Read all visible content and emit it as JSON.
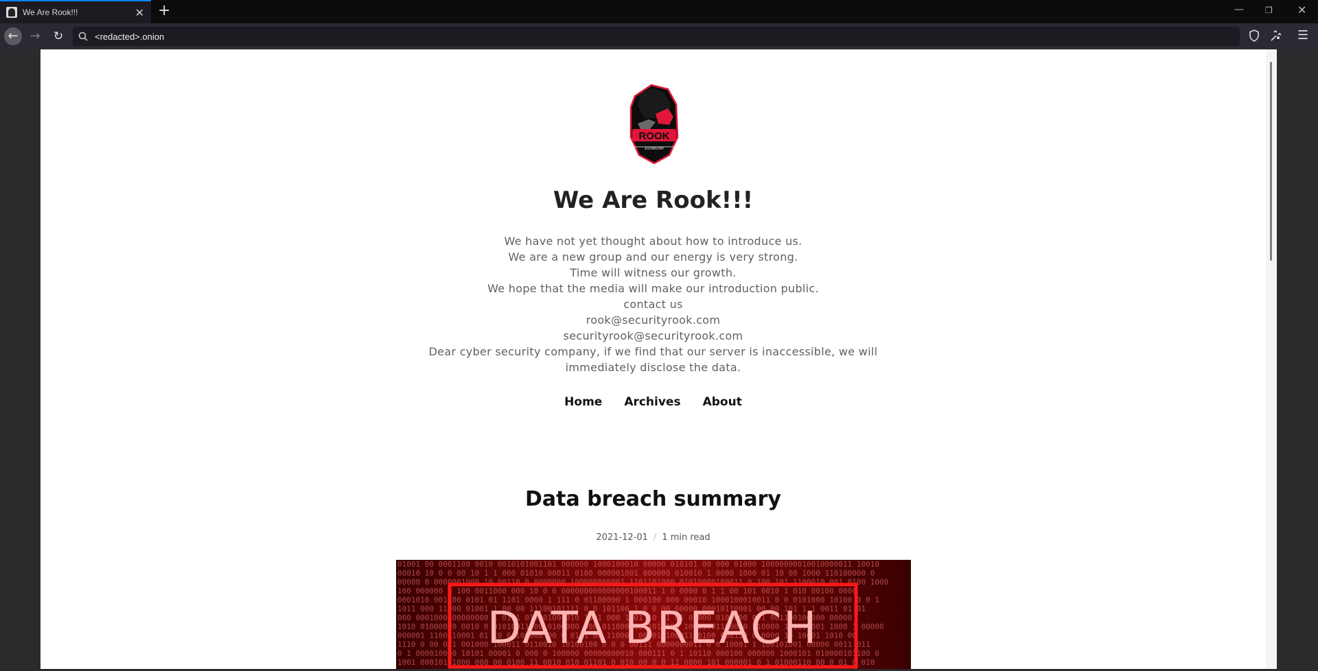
{
  "browser": {
    "tab_title": "We Are Rook!!!",
    "url": "<redacted>.onion"
  },
  "site": {
    "logo_text": "ROOK",
    "logo_subtext": "ESTABLISH",
    "title": "We Are Rook!!!",
    "intro": [
      "We have not yet thought about how to introduce us.",
      "We are a new group and our energy is very strong.",
      "Time will witness our growth.",
      "We hope that the media will make our introduction public.",
      "contact us",
      "rook@securityrook.com",
      "securityrook@securityrook.com",
      "Dear cyber security company, if we find that our server is inaccessible, we will",
      "immediately disclose the data."
    ],
    "nav": [
      "Home",
      "Archives",
      "About"
    ]
  },
  "post": {
    "title": "Data breach summary",
    "date": "2021-12-01",
    "read_time": "1 min read",
    "hero_text": "DATA BREACH"
  },
  "colors": {
    "accent_tab": "#0a84ff",
    "logo_red": "#e0173a",
    "hero_red": "#ff2020"
  }
}
